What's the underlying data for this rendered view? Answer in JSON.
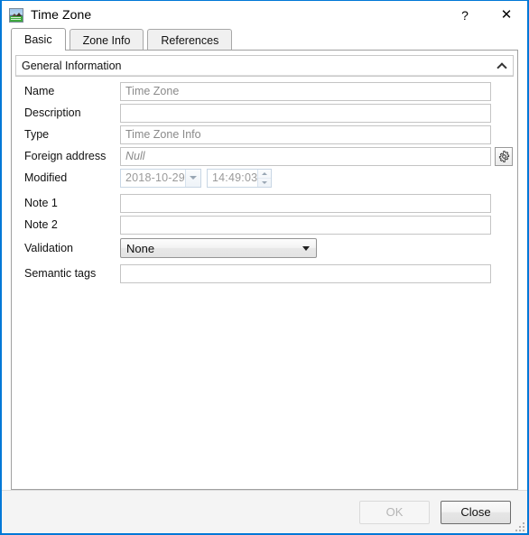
{
  "window": {
    "title": "Time Zone",
    "icon": "image-thumbnail-icon",
    "help_label": "?",
    "close_label": "✕",
    "accent_color": "#0078d7"
  },
  "tabs": [
    {
      "label": "Basic",
      "active": true
    },
    {
      "label": "Zone Info",
      "active": false
    },
    {
      "label": "References",
      "active": false
    }
  ],
  "group": {
    "title": "General Information",
    "collapse_icon": "chevron-up-icon"
  },
  "fields": {
    "name": {
      "label": "Name",
      "value": "",
      "placeholder": "Time Zone"
    },
    "description": {
      "label": "Description",
      "value": "",
      "placeholder": ""
    },
    "type": {
      "label": "Type",
      "value": "",
      "placeholder": "Time Zone Info"
    },
    "foreign_address": {
      "label": "Foreign address",
      "value": "",
      "placeholder": "Null",
      "button_icon": "gear-icon"
    },
    "modified": {
      "label": "Modified",
      "date": "2018-10-29",
      "time": "14:49:03",
      "date_dropdown_icon": "chevron-down-icon",
      "time_spinner_icon": "spinner-up-down-icon"
    },
    "note1": {
      "label": "Note 1",
      "value": "",
      "placeholder": ""
    },
    "note2": {
      "label": "Note 2",
      "value": "",
      "placeholder": ""
    },
    "validation": {
      "label": "Validation",
      "selected": "None",
      "options": [
        "None"
      ],
      "arrow_icon": "chevron-down-icon"
    },
    "semantic_tags": {
      "label": "Semantic tags",
      "value": "",
      "placeholder": ""
    }
  },
  "footer": {
    "ok_label": "OK",
    "ok_disabled": true,
    "close_label": "Close",
    "resize_grip": "resize-grip-icon"
  }
}
